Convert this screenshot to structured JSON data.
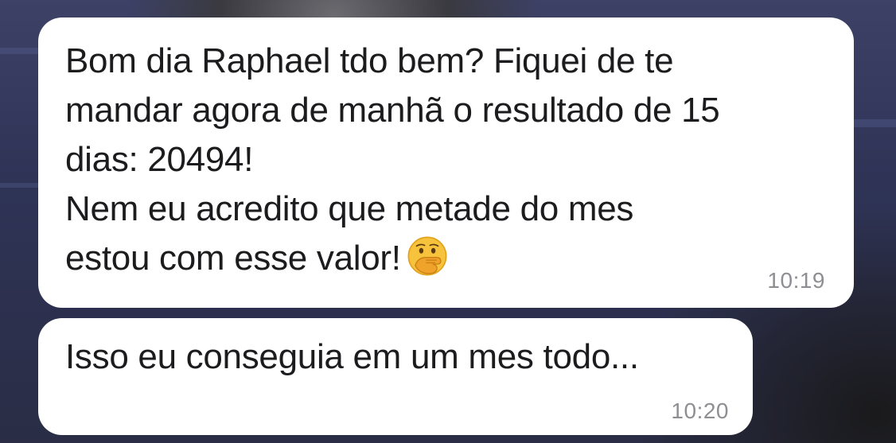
{
  "messages": [
    {
      "lines": [
        "Bom dia Raphael tdo bem? Fiquei de te",
        "mandar agora de manhã o resultado de 15",
        "dias: 20494!",
        "Nem eu acredito que metade do mes",
        "estou com esse valor!"
      ],
      "emoji": "face-with-hand-over-mouth",
      "time": "10:19"
    },
    {
      "lines": [
        "Isso eu conseguia em um mes todo..."
      ],
      "time": "10:20"
    }
  ],
  "colors": {
    "bubble": "#ffffff",
    "text": "#1c1c1e",
    "timestamp": "#8e8e93",
    "background": "#2f3457"
  }
}
